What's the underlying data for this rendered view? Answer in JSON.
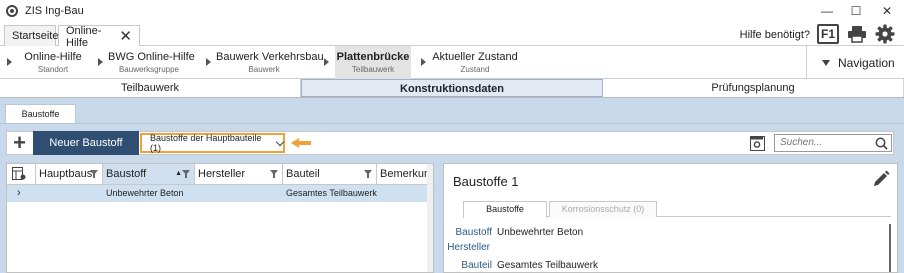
{
  "window": {
    "title": "ZIS Ing-Bau",
    "minimize_glyph": "—",
    "maximize_glyph": "☐",
    "close_glyph": "✕"
  },
  "tabs": [
    {
      "label": "Startseite"
    },
    {
      "label": "Online-Hilfe"
    }
  ],
  "help": {
    "text": "Hilfe benötigt?",
    "f1_label": "F1"
  },
  "breadcrumb": [
    {
      "main": "Online-Hilfe",
      "sub": "Standort"
    },
    {
      "main": "BWG Online-Hilfe",
      "sub": "Bauwerksgruppe"
    },
    {
      "main": "Bauwerk Verkehrsbau",
      "sub": "Bauwerk"
    },
    {
      "main": "Plattenbrücke",
      "sub": "Teilbauwerk"
    },
    {
      "main": "Aktueller Zustand",
      "sub": "Zustand"
    }
  ],
  "navigation_label": "Navigation",
  "sections": [
    {
      "label": "Teilbauwerk"
    },
    {
      "label": "Konstruktionsdaten"
    },
    {
      "label": "Prüfungsplanung"
    }
  ],
  "sub_tab": "Baustoffe",
  "toolbar": {
    "plus_glyph": "+",
    "new_label": "Neuer Baustoff",
    "filter_label": "Baustoffe der Hauptbauteile (1)",
    "search_placeholder": "Suchen..."
  },
  "grid": {
    "columns": [
      "Hauptbaus",
      "Baustoff",
      "Hersteller",
      "Bauteil",
      "Bemerkung"
    ],
    "rows": [
      {
        "expander": "›",
        "hauptbaustoff": "",
        "baustoff": "Unbewehrter Beton",
        "hersteller": "",
        "bauteil": "Gesamtes Teilbauwerk",
        "bemerkung": ""
      }
    ]
  },
  "panel": {
    "title": "Baustoffe 1",
    "tabs": [
      {
        "label": "Baustoffe"
      },
      {
        "label": "Korrosionsschutz (0)"
      }
    ],
    "fields": [
      {
        "label": "Baustoff",
        "value": "Unbewehrter Beton"
      },
      {
        "label": "Hersteller",
        "value": ""
      },
      {
        "label": "Bauteil",
        "value": "Gesamtes Teilbauwerk"
      }
    ]
  },
  "colors": {
    "accent_dark_blue": "#2f4e71",
    "highlight_orange": "#f0a239",
    "content_background": "#c9d9ec",
    "selected_row": "#cfe0f1",
    "label_blue": "#2d5b8c"
  },
  "icons": [
    "app-icon",
    "close-icon",
    "printer-icon",
    "gear-icon",
    "navigation-triangle-icon",
    "plus-icon",
    "chevron-down-icon",
    "orange-arrow-icon",
    "calendar-settings-icon",
    "search-icon",
    "column-settings-icon",
    "filter-icon",
    "sort-icon",
    "pencil-icon"
  ]
}
